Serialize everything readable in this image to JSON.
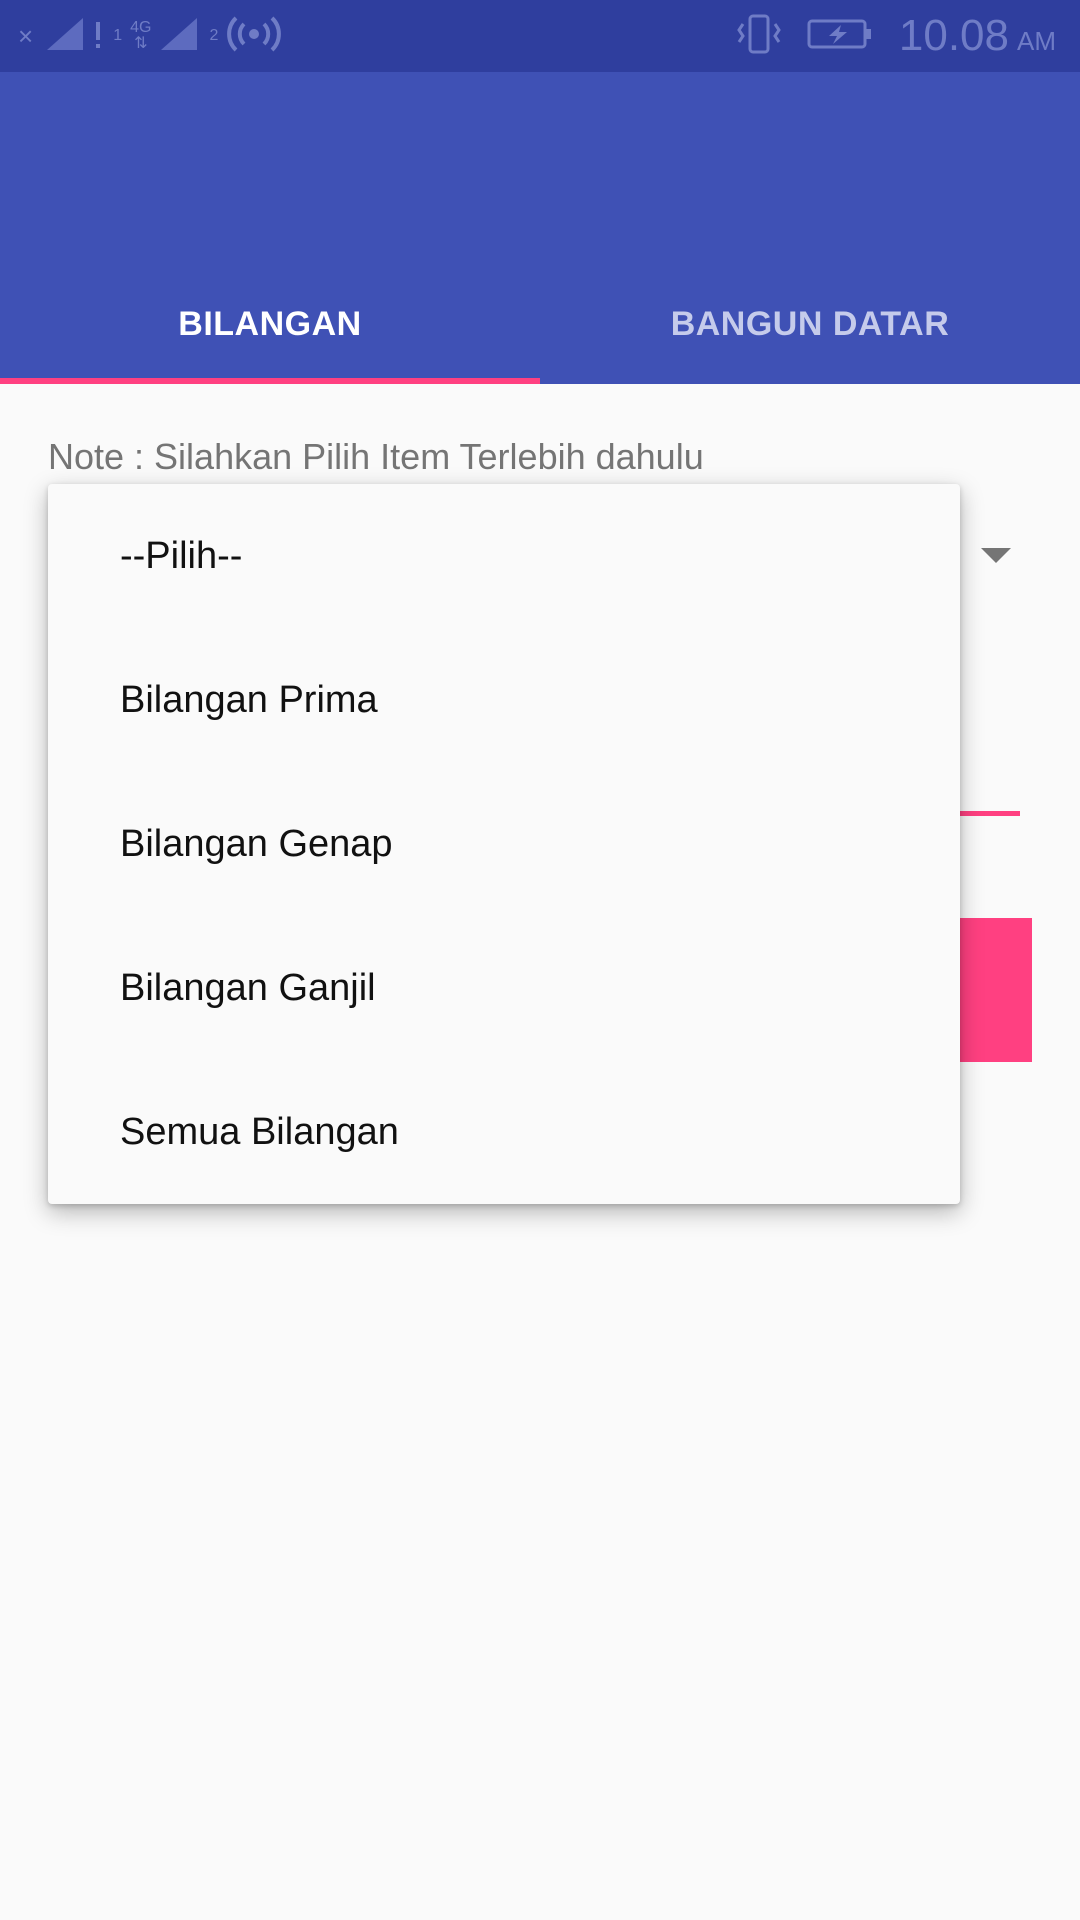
{
  "status_bar": {
    "x_glyph": "×",
    "sim1_label": "1",
    "network_type": "4G",
    "sim2_label": "2",
    "time": "10.08",
    "ampm": "AM"
  },
  "tabs": [
    {
      "label": "BILANGAN",
      "active": true
    },
    {
      "label": "BANGUN DATAR",
      "active": false
    }
  ],
  "content": {
    "note": "Note : Silahkan Pilih Item Terlebih dahulu"
  },
  "dropdown": {
    "options": [
      "--Pilih--",
      "Bilangan Prima",
      "Bilangan Genap",
      "Bilangan Ganjil",
      "Semua Bilangan"
    ]
  },
  "colors": {
    "status_bar": "#2f3e9e",
    "primary": "#3f51b5",
    "accent": "#ff4081",
    "background": "#fafafa"
  }
}
